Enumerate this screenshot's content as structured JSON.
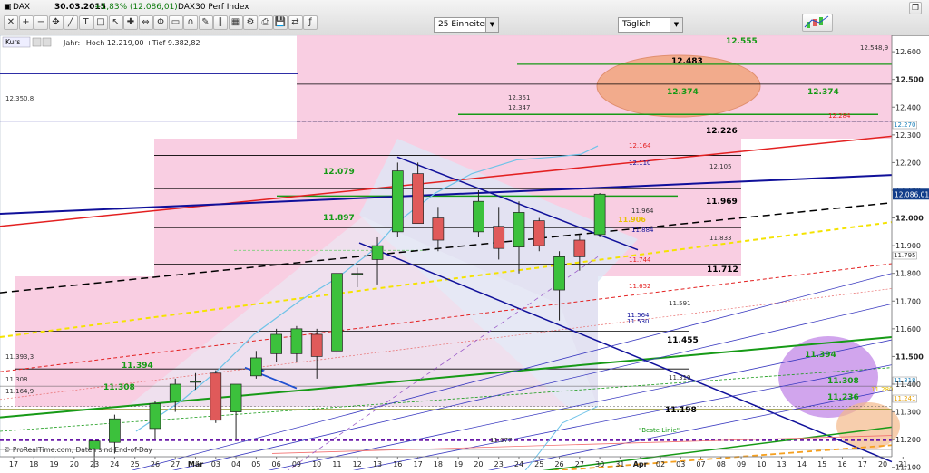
{
  "header": {
    "instrument": "DAX",
    "date": "30.03.2015",
    "change": "+1,83% (12.086,01)",
    "index_name": "DAX30 Perf Index",
    "units_select": "25 Einheiten",
    "period_select": "Täglich",
    "dropdown_arrow": "▼"
  },
  "panel": {
    "label": "Kurs",
    "info": "Jahr:+Hoch 12.219,00 +Tief 9.382,82",
    "source": "© ProRealTime.com, Daten sind End-of-Day",
    "best_line_label": "\"Beste Linie\""
  },
  "icons": [
    "close-icon",
    "zoom-in-icon",
    "zoom-out-icon",
    "pan-icon",
    "draw-line-icon",
    "text-icon",
    "shape-icon",
    "cursor-icon",
    "crosshair-icon",
    "measure-icon",
    "fib-icon",
    "ruler-icon",
    "magnet-icon",
    "pen-icon",
    "channel-icon",
    "grid-icon",
    "settings-icon",
    "print-icon",
    "save-icon",
    "compare-icon",
    "indicator-icon"
  ],
  "colors": {
    "up_candle": "#3cc13c",
    "down_candle": "#e05a5a",
    "pink_zone": "#f8c6dd",
    "channel_fill": "#dde7f6",
    "blue_line": "#10109a",
    "red_line": "#e32020",
    "green_line": "#169a16",
    "ma_line": "#6fc3e8",
    "price_box": "#123d8a"
  },
  "chart_data": {
    "type": "candlestick",
    "ylim": [
      11050,
      12620
    ],
    "yticks": [
      "11.100",
      "11.200",
      "11.300",
      "11.400",
      "11.500",
      "11.600",
      "11.700",
      "11.800",
      "11.900",
      "12.000",
      "12.100",
      "12.200",
      "12.300",
      "12.400",
      "12.500",
      "12.600"
    ],
    "xlabels": [
      "17",
      "18",
      "19",
      "20",
      "23",
      "24",
      "25",
      "26",
      "27",
      "Mär",
      "03",
      "04",
      "05",
      "06",
      "09",
      "10",
      "11",
      "12",
      "13",
      "16",
      "17",
      "18",
      "19",
      "20",
      "23",
      "24",
      "25",
      "26",
      "27",
      "30",
      "31",
      "Apr",
      "02",
      "03",
      "07",
      "08",
      "09",
      "10",
      "13",
      "14",
      "15",
      "16",
      "17",
      "20",
      "21"
    ],
    "candles": [
      {
        "date": "23",
        "o": 11165,
        "h": 11195,
        "l": 11100,
        "c": 11195
      },
      {
        "date": "24",
        "o": 11190,
        "h": 11290,
        "l": 11150,
        "c": 11275
      },
      {
        "date": "26",
        "o": 11240,
        "h": 11340,
        "l": 11200,
        "c": 11330
      },
      {
        "date": "27",
        "o": 11340,
        "h": 11420,
        "l": 11300,
        "c": 11400
      },
      {
        "date": "Mär",
        "o": 11410,
        "h": 11440,
        "l": 11380,
        "c": 11410
      },
      {
        "date": "03",
        "o": 11440,
        "h": 11450,
        "l": 11260,
        "c": 11270
      },
      {
        "date": "04",
        "o": 11300,
        "h": 11400,
        "l": 11200,
        "c": 11400
      },
      {
        "date": "05",
        "o": 11430,
        "h": 11520,
        "l": 11420,
        "c": 11495
      },
      {
        "date": "06",
        "o": 11510,
        "h": 11600,
        "l": 11480,
        "c": 11580
      },
      {
        "date": "09",
        "o": 11510,
        "h": 11610,
        "l": 11480,
        "c": 11600
      },
      {
        "date": "10",
        "o": 11580,
        "h": 11600,
        "l": 11420,
        "c": 11500
      },
      {
        "date": "11",
        "o": 11520,
        "h": 11805,
        "l": 11500,
        "c": 11800
      },
      {
        "date": "12",
        "o": 11800,
        "h": 11820,
        "l": 11750,
        "c": 11800
      },
      {
        "date": "13",
        "o": 11850,
        "h": 11930,
        "l": 11760,
        "c": 11900
      },
      {
        "date": "16",
        "o": 11950,
        "h": 12200,
        "l": 11930,
        "c": 12170
      },
      {
        "date": "17",
        "o": 12160,
        "h": 12200,
        "l": 11990,
        "c": 11980
      },
      {
        "date": "18",
        "o": 12000,
        "h": 12040,
        "l": 11880,
        "c": 11920
      },
      {
        "date": "20",
        "o": 11950,
        "h": 12100,
        "l": 11930,
        "c": 12060
      },
      {
        "date": "23",
        "o": 11970,
        "h": 12040,
        "l": 11850,
        "c": 11890
      },
      {
        "date": "24",
        "o": 11895,
        "h": 12060,
        "l": 11800,
        "c": 12020
      },
      {
        "date": "25",
        "o": 11990,
        "h": 12000,
        "l": 11880,
        "c": 11900
      },
      {
        "date": "26",
        "o": 11740,
        "h": 11880,
        "l": 11630,
        "c": 11860
      },
      {
        "date": "27",
        "o": 11920,
        "h": 11940,
        "l": 11810,
        "c": 11860
      },
      {
        "date": "30",
        "o": 11940,
        "h": 12090,
        "l": 11930,
        "c": 12086
      }
    ],
    "levels": [
      {
        "label": "12.555",
        "value": 12555,
        "color": "#169a16"
      },
      {
        "label": "12.548,9",
        "value": 12549,
        "color": "#333"
      },
      {
        "label": "12.483",
        "value": 12483,
        "color": "#000"
      },
      {
        "label": "12.374",
        "value": 12374,
        "color": "#169a16"
      },
      {
        "label": "12.374",
        "value": 12374,
        "color": "#169a16"
      },
      {
        "label": "12.351",
        "value": 12351,
        "color": "#333"
      },
      {
        "label": "12.350,8",
        "value": 12351,
        "color": "#333"
      },
      {
        "label": "12.347",
        "value": 12347,
        "color": "#333"
      },
      {
        "label": "12.284",
        "value": 12284,
        "color": "#e32020"
      },
      {
        "label": "12.270",
        "value": 12270,
        "color": "#6fc3e8"
      },
      {
        "label": "12.226",
        "value": 12226,
        "color": "#000"
      },
      {
        "label": "12.164",
        "value": 12164,
        "color": "#e32020"
      },
      {
        "label": "12.110",
        "value": 12110,
        "color": "#10109a"
      },
      {
        "label": "12.105",
        "value": 12105,
        "color": "#333"
      },
      {
        "label": "12.079",
        "value": 12079,
        "color": "#169a16"
      },
      {
        "label": "11.969",
        "value": 11969,
        "color": "#000"
      },
      {
        "label": "11.964",
        "value": 11964,
        "color": "#333"
      },
      {
        "label": "11.906",
        "value": 11906,
        "color": "#e8c000"
      },
      {
        "label": "11.897",
        "value": 11897,
        "color": "#169a16"
      },
      {
        "label": "11.884",
        "value": 11884,
        "color": "#10109a"
      },
      {
        "label": "11.833",
        "value": 11833,
        "color": "#333"
      },
      {
        "label": "11.795",
        "value": 11795,
        "color": "#333"
      },
      {
        "label": "11.744",
        "value": 11744,
        "color": "#e32020"
      },
      {
        "label": "11.712",
        "value": 11712,
        "color": "#000"
      },
      {
        "label": "11.652",
        "value": 11652,
        "color": "#e32020"
      },
      {
        "label": "11.591",
        "value": 11591,
        "color": "#333"
      },
      {
        "label": "11.564",
        "value": 11564,
        "color": "#10109a"
      },
      {
        "label": "11.530",
        "value": 11530,
        "color": "#10109a"
      },
      {
        "label": "11.455",
        "value": 11455,
        "color": "#000"
      },
      {
        "label": "11.394",
        "value": 11394,
        "color": "#169a16"
      },
      {
        "label": "11.394",
        "value": 11394,
        "color": "#169a16"
      },
      {
        "label": "11.393,3",
        "value": 11393,
        "color": "#333"
      },
      {
        "label": "11.319",
        "value": 11319,
        "color": "#333"
      },
      {
        "label": "11.318",
        "value": 11318,
        "color": "#6fc3e8"
      },
      {
        "label": "11.308",
        "value": 11308,
        "color": "#169a16"
      },
      {
        "label": "11.308",
        "value": 11308,
        "color": "#169a16"
      },
      {
        "label": "11.308",
        "value": 11308,
        "color": "#333"
      },
      {
        "label": "11.280",
        "value": 11280,
        "color": "#e8c000"
      },
      {
        "label": "11.236",
        "value": 11236,
        "color": "#169a16"
      },
      {
        "label": "11.241",
        "value": 11241,
        "color": "#e8c000"
      },
      {
        "label": "11.198",
        "value": 11198,
        "color": "#000"
      },
      {
        "label": "11.164,9",
        "value": 11165,
        "color": "#333"
      },
      {
        "label": "11.077",
        "value": 11077,
        "color": "#333"
      }
    ],
    "current_price": "12.086,01"
  }
}
